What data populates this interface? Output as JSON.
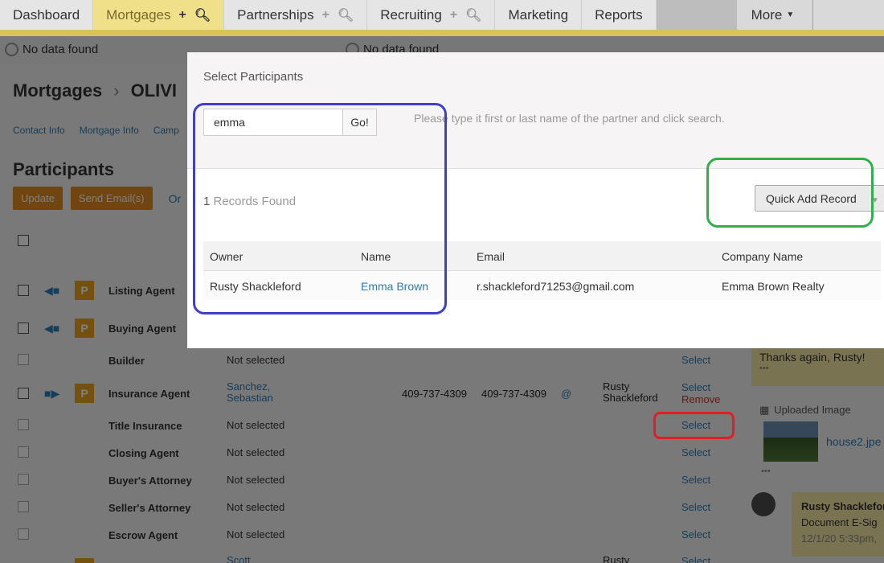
{
  "topnav": {
    "tabs": [
      {
        "label": "Dashboard"
      },
      {
        "label": "Mortgages"
      },
      {
        "label": "Partnerships"
      },
      {
        "label": "Recruiting"
      },
      {
        "label": "Marketing"
      },
      {
        "label": "Reports"
      }
    ],
    "more_label": "More"
  },
  "subbar": {
    "no_data_1": "No data found",
    "no_data_2": "No data found"
  },
  "breadcrumb": {
    "section": "Mortgages",
    "record": "OLIVI"
  },
  "record_tabs": [
    "Contact Info",
    "Mortgage Info",
    "Camp"
  ],
  "participants": {
    "title": "Participants",
    "update_label": "Update",
    "send_email_label": "Send Email(s)",
    "other_label": "Or",
    "rows": [
      {
        "role": "Listing Agent",
        "who": "",
        "ph1": "",
        "ph2": "",
        "owner": "",
        "select": "",
        "remove": ""
      },
      {
        "role": "Buying Agent",
        "who": "",
        "ph1": "",
        "ph2": "",
        "owner": "",
        "select": "",
        "remove": ""
      },
      {
        "role": "Builder",
        "who": "Not selected",
        "ph1": "",
        "ph2": "",
        "owner": "",
        "select": "Select",
        "remove": ""
      },
      {
        "role": "Insurance Agent",
        "who": "Sanchez,\nSebastian",
        "ph1": "409-737-4309",
        "ph2": "409-737-4309",
        "owner": "Rusty\nShackleford",
        "select": "Select",
        "remove": "Remove"
      },
      {
        "role": "Title Insurance",
        "who": "Not selected",
        "ph1": "",
        "ph2": "",
        "owner": "",
        "select": "Select",
        "remove": ""
      },
      {
        "role": "Closing Agent",
        "who": "Not selected",
        "ph1": "",
        "ph2": "",
        "owner": "",
        "select": "Select",
        "remove": ""
      },
      {
        "role": "Buyer's Attorney",
        "who": "Not selected",
        "ph1": "",
        "ph2": "",
        "owner": "",
        "select": "Select",
        "remove": ""
      },
      {
        "role": "Seller's Attorney",
        "who": "Not selected",
        "ph1": "",
        "ph2": "",
        "owner": "",
        "select": "Select",
        "remove": ""
      },
      {
        "role": "Escrow Agent",
        "who": "Not selected",
        "ph1": "",
        "ph2": "",
        "owner": "",
        "select": "Select",
        "remove": ""
      }
    ],
    "partial_row": {
      "who": "Scott",
      "owner": "Rusty",
      "select": "Select"
    },
    "p_badge": "P"
  },
  "activity": {
    "note1": "Thanks again, Rusty!",
    "upload_header": "Uploaded Image",
    "file_name": "house2.jpe",
    "note2_author": "Rusty Shacklefor",
    "note2_line": "Document E-Sig",
    "note2_time": "12/1/20 5:33pm,",
    "dots": "•••"
  },
  "modal": {
    "title": "Select Participants",
    "search_value": "emma",
    "go_label": "Go!",
    "hint": "Please type it first or last name of the partner and click search.",
    "records_count": "1",
    "records_label": " Records Found",
    "quick_add_label": "Quick Add Record",
    "columns": [
      "Owner",
      "Name",
      "Email",
      "Company Name"
    ],
    "results": [
      {
        "owner": "Rusty Shackleford",
        "name": "Emma Brown",
        "email": "r.shackleford71253@gmail.com",
        "company": "Emma Brown Realty"
      }
    ]
  },
  "colors": {
    "accent": "#2d7bb5",
    "highlight": "#f1e08a",
    "button_orange": "#e08a1f",
    "annotation_blue": "#3f3fc7",
    "annotation_green": "#2fb04a",
    "annotation_red": "#e51d23"
  }
}
